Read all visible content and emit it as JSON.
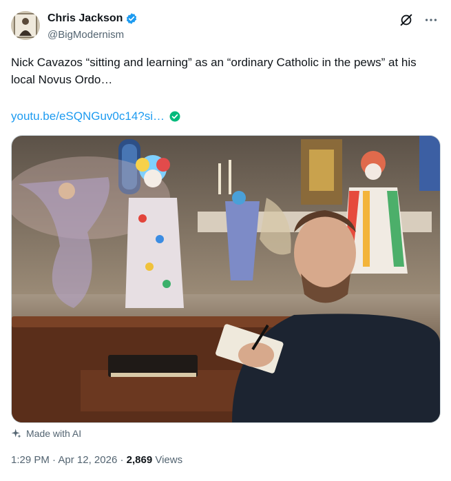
{
  "author": {
    "display_name": "Chris Jackson",
    "handle": "@BigModernism",
    "verified": true
  },
  "icons": {
    "verified": "verified-badge-icon",
    "grok": "grok-icon",
    "more": "more-icon",
    "link_check": "check-icon",
    "ai": "sparkle-icon"
  },
  "tweet": {
    "text": "Nick Cavazos “sitting and learning” as an “ordinary Catholic in the pews” at his local Novus Ordo…",
    "link": "youtu.be/eSQNGuv0c14?si…"
  },
  "ai_label": "Made with AI",
  "meta": {
    "time": "1:29 PM",
    "sep1": "·",
    "date": "Apr 12, 2026",
    "sep2": "·",
    "views_count": "2,869",
    "views_label": "Views"
  },
  "colors": {
    "link": "#1d9bf0",
    "verified": "#1d9bf0",
    "muted": "#536471",
    "text": "#0f1419"
  }
}
